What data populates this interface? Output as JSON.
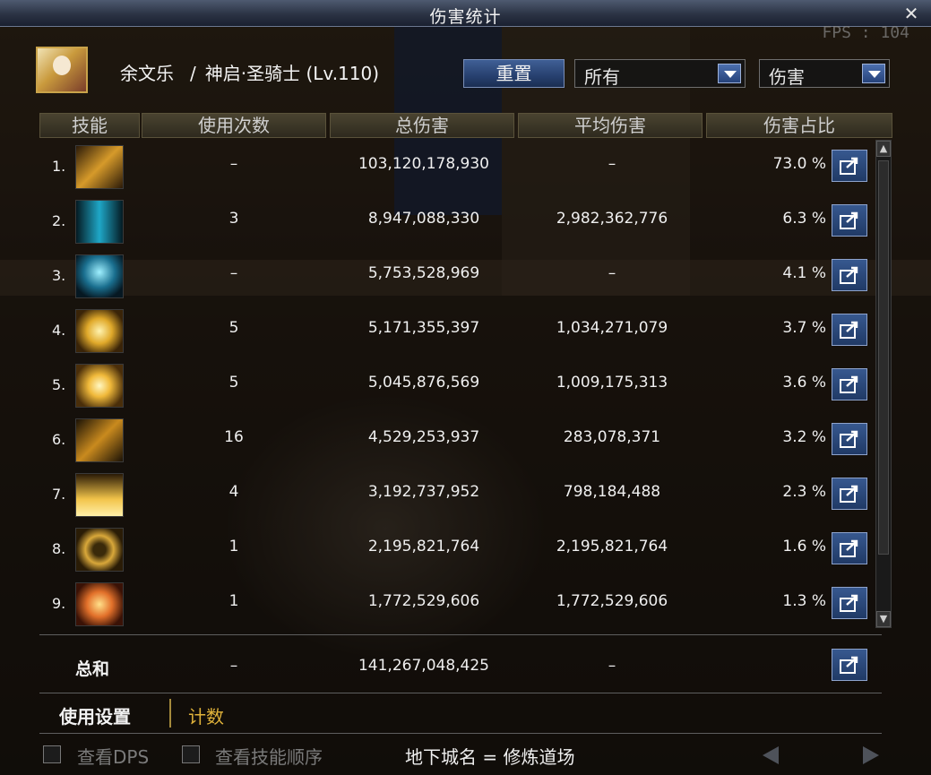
{
  "window": {
    "title": "伤害统计",
    "close_label": "✕",
    "fps_text": "FPS : 104"
  },
  "player": {
    "name": "余文乐",
    "separator": "/",
    "job_level": "神启·圣骑士 (Lv.110)"
  },
  "toolbar": {
    "reset_label": "重置",
    "filter_value": "所有",
    "metric_value": "伤害"
  },
  "columns": [
    "技能",
    "使用次数",
    "总伤害",
    "平均伤害",
    "伤害占比"
  ],
  "rows": [
    {
      "index": "1.",
      "icon": "golden-sword-skill-icon",
      "count": "–",
      "total": "103,120,178,930",
      "avg": "–",
      "pct": "73.0 %"
    },
    {
      "index": "2.",
      "icon": "blue-pillar-skill-icon",
      "count": "3",
      "total": "8,947,088,330",
      "avg": "2,982,362,776",
      "pct": "6.3 %"
    },
    {
      "index": "3.",
      "icon": "blue-lightning-skill-icon",
      "count": "–",
      "total": "5,753,528,969",
      "avg": "–",
      "pct": "4.1 %"
    },
    {
      "index": "4.",
      "icon": "golden-cross-burst-skill-icon",
      "count": "5",
      "total": "5,171,355,397",
      "avg": "1,034,271,079",
      "pct": "3.7 %"
    },
    {
      "index": "5.",
      "icon": "holy-cross-skill-icon",
      "count": "5",
      "total": "5,045,876,569",
      "avg": "1,009,175,313",
      "pct": "3.6 %"
    },
    {
      "index": "6.",
      "icon": "crescent-slash-skill-icon",
      "count": "16",
      "total": "4,529,253,937",
      "avg": "283,078,371",
      "pct": "3.2 %"
    },
    {
      "index": "7.",
      "icon": "light-beam-skill-icon",
      "count": "4",
      "total": "3,192,737,952",
      "avg": "798,184,488",
      "pct": "2.3 %"
    },
    {
      "index": "8.",
      "icon": "golden-shield-skill-icon",
      "count": "1",
      "total": "2,195,821,764",
      "avg": "2,195,821,764",
      "pct": "1.6 %"
    },
    {
      "index": "9.",
      "icon": "sun-burst-skill-icon",
      "count": "1",
      "total": "1,772,529,606",
      "avg": "1,772,529,606",
      "pct": "1.3 %"
    }
  ],
  "total": {
    "label": "总和",
    "count": "–",
    "total": "141,267,048,425",
    "avg": "–"
  },
  "tabs": {
    "usage_settings": "使用设置",
    "count": "计数"
  },
  "footer": {
    "view_dps": "查看DPS",
    "view_skill_order": "查看技能顺序",
    "dungeon": "地下城名 = 修炼道场"
  },
  "colors": {
    "accent_blue": "#2b4a7f",
    "gold": "#e0b23a",
    "header_bg": "#3a3426"
  }
}
